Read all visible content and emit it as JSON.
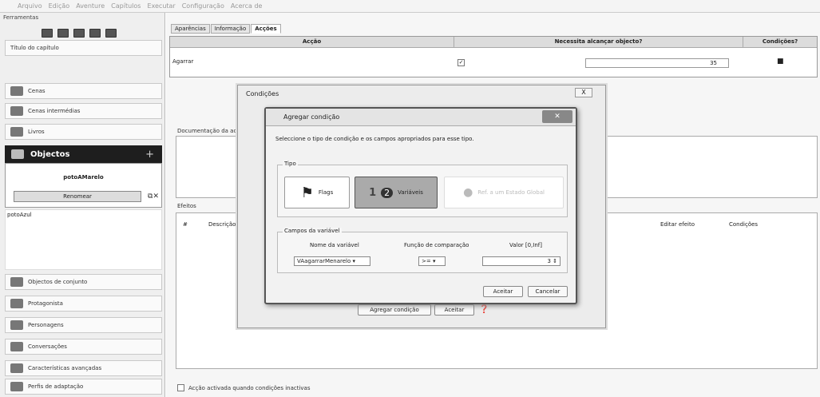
{
  "menu": [
    "Arquivo",
    "Edição",
    "Aventure",
    "Capítulos",
    "Executar",
    "Configuração",
    "Acerca de"
  ],
  "sidebar": {
    "tools_label": "Ferramentas",
    "chapter_title": "Título do capítulo",
    "items_top": [
      "Cenas",
      "Cenas intermédias",
      "Livros"
    ],
    "objects_header": "Objectos",
    "objects_plus": "+",
    "object_name": "potoAMarelo",
    "rename_label": "Renomear",
    "object_list_item": "potoAzul",
    "items_bottom": [
      "Objectos de conjunto",
      "Protagonista",
      "Personagens",
      "Conversações",
      "Características avançadas",
      "Perfis de adaptação"
    ]
  },
  "tabs": [
    "Aparências",
    "Informação",
    "Acções"
  ],
  "actions_table": {
    "headers": [
      "Acção",
      "Necessita alcançar objecto?",
      "Condições?"
    ],
    "row_action": "Agarrar",
    "row_distance": "35"
  },
  "documentation_label": "Documentação da acção",
  "effects": {
    "label": "Efeitos",
    "col_hash": "#",
    "col_desc": "Descrição",
    "col_edit": "Editar efeito",
    "col_cond": "Condições"
  },
  "footer_checkbox": "Acção activada quando condições inactivas",
  "conditions_dialog": {
    "title": "Condições",
    "close": "X",
    "add_condition": "Agregar condição",
    "accept": "Aceitar"
  },
  "add_condition_dialog": {
    "title": "Agregar condição",
    "instruction": "Seleccione o tipo de condição e os campos apropriados para esse tipo.",
    "type_group": "Tipo",
    "types": [
      "Flags",
      "Variáveis",
      "Ref. a um Estado Global"
    ],
    "badge_1": "1",
    "badge_2": "2",
    "fields_group": "Campos da variável",
    "var_name_label": "Nome da variável",
    "var_name_value": "VAagarrarMenarelo",
    "compare_label": "Função de comparação",
    "compare_value": ">=",
    "value_label": "Valor [0,Inf]",
    "value_value": "3",
    "accept": "Aceitar",
    "cancel": "Cancelar"
  }
}
